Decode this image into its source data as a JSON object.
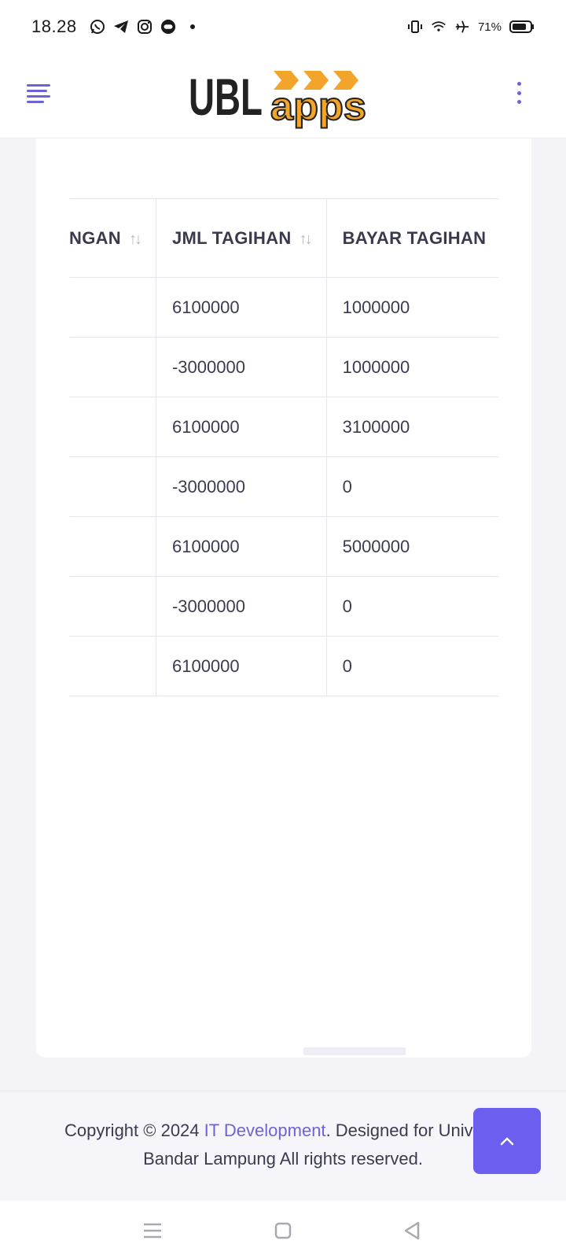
{
  "status_bar": {
    "time": "18.28",
    "battery": "71%",
    "notification_icons": [
      "whatsapp-icon",
      "telegram-icon",
      "instagram-icon",
      "chat-icon"
    ],
    "system_icons": [
      "vibrate-icon",
      "wifi-icon",
      "airplane-icon",
      "battery-icon"
    ]
  },
  "header": {
    "logo_primary": "UBL",
    "logo_secondary": "apps",
    "menu_icon": "hamburger-menu-icon",
    "more_icon": "kebab-menu-icon",
    "accent_color": "#6c63d9",
    "logo_accent": "#f2a52a"
  },
  "table": {
    "columns": [
      {
        "label": "NGAN",
        "sortable": true
      },
      {
        "label": "JML TAGIHAN",
        "sortable": true
      },
      {
        "label": "BAYAR TAGIHAN",
        "sortable": false
      }
    ],
    "rows": [
      [
        "",
        "6100000",
        "1000000"
      ],
      [
        "",
        "-3000000",
        "1000000"
      ],
      [
        "",
        "6100000",
        "3100000"
      ],
      [
        "",
        "-3000000",
        "0"
      ],
      [
        "",
        "6100000",
        "5000000"
      ],
      [
        "",
        "-3000000",
        "0"
      ],
      [
        "",
        "6100000",
        "0"
      ]
    ]
  },
  "footer": {
    "copyright_prefix": "Copyright © 2024 ",
    "company_link": "IT Development",
    "designed_for": ". Designed for Univ",
    "line2": "Bandar Lampung All rights reserved."
  },
  "scroll_top": {
    "icon": "chevron-up-icon",
    "color": "#6c5fef"
  },
  "nav_bar": {
    "icons": [
      "recent-apps-icon",
      "home-icon",
      "back-icon"
    ]
  }
}
